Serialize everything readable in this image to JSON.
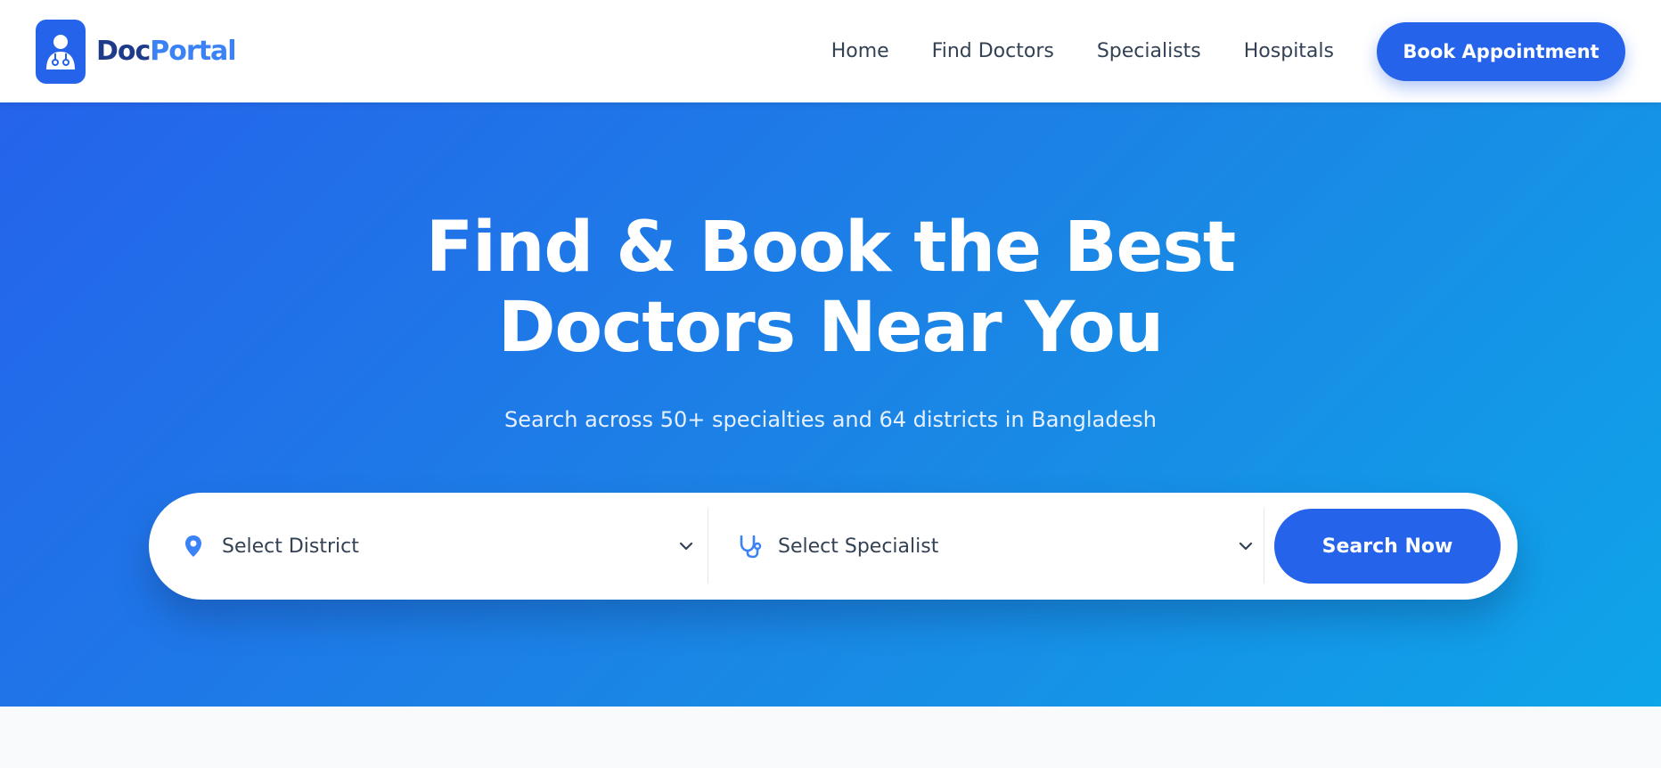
{
  "brand": {
    "name_part1": "Doc",
    "name_part2": "Portal",
    "logo_icon": "doctor-icon"
  },
  "nav": {
    "links": [
      "Home",
      "Find Doctors",
      "Specialists",
      "Hospitals"
    ],
    "cta_label": "Book Appointment"
  },
  "hero": {
    "title_line1": "Find & Book the Best",
    "title_line2": "Doctors Near You",
    "subtitle": "Search across 50+ specialties and 64 districts in Bangladesh"
  },
  "search": {
    "district_placeholder": "Select District",
    "district_icon": "location-pin-icon",
    "specialist_placeholder": "Select Specialist",
    "specialist_icon": "stethoscope-icon",
    "button_label": "Search Now"
  },
  "colors": {
    "primary": "#2563eb",
    "brand_dark": "#1e3a8a",
    "brand_light": "#3b82f6",
    "hero_gradient_start": "#2563eb",
    "hero_gradient_end": "#0ea5e9",
    "nav_text": "#334155"
  }
}
